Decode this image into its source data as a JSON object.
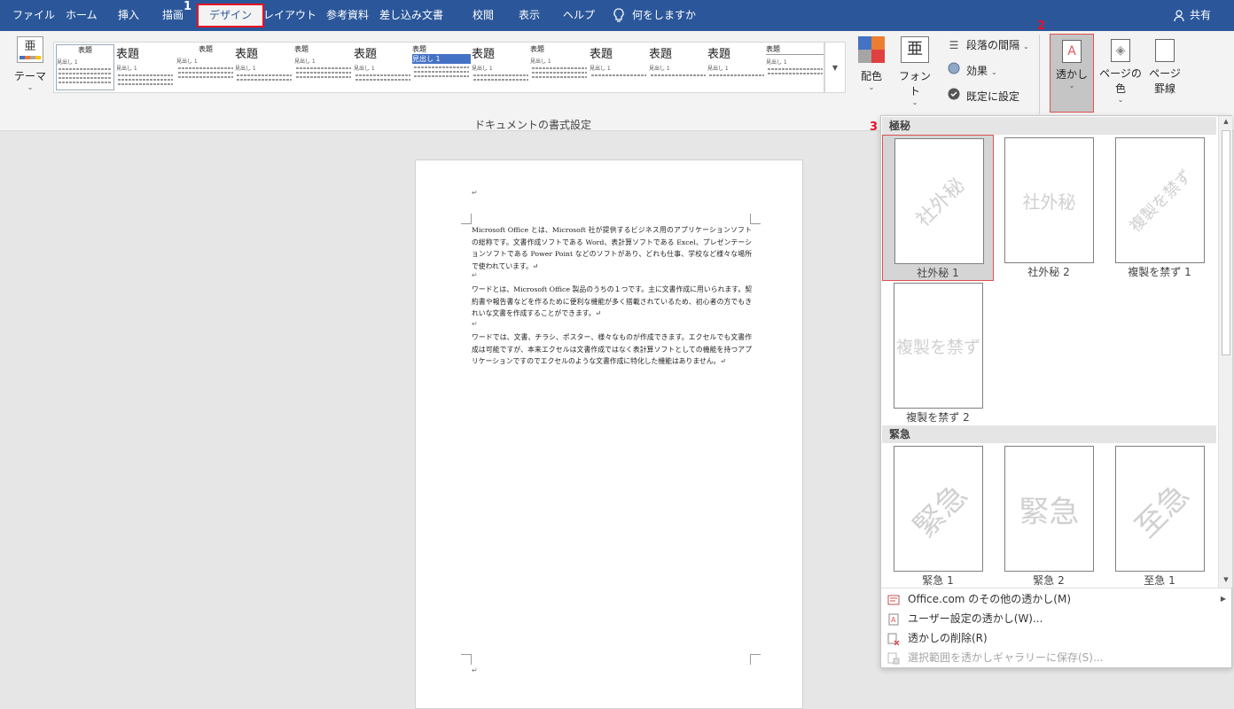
{
  "tabs": [
    "ファイル",
    "ホーム",
    "挿入",
    "描画",
    "デザイン",
    "レイアウト",
    "参考資料",
    "差し込み文書",
    "校閲",
    "表示",
    "ヘルプ"
  ],
  "tell_me": "何をしますか",
  "share": "共有",
  "steps": [
    "1",
    "2",
    "3"
  ],
  "ribbon": {
    "theme_label": "テーマ",
    "theme_glyph": "亜",
    "style_gallery": [
      {
        "title": "表題",
        "h": "見出し 1"
      },
      {
        "title": "表題",
        "h": "見出し 1"
      },
      {
        "title": "表題",
        "h": "見出し 1"
      },
      {
        "title": "表題",
        "h": "見出し 1"
      },
      {
        "title": "表題",
        "h": "見出し 1"
      },
      {
        "title": "表題",
        "h": "見出し 1"
      },
      {
        "title": "表題",
        "h": "見出し 1"
      },
      {
        "title": "表題",
        "h": "見出し 1"
      },
      {
        "title": "表題",
        "h": "見出し 1"
      },
      {
        "title": "表題",
        "h": "見出し 1"
      },
      {
        "title": "表題",
        "h": "見出し 1"
      },
      {
        "title": "表題",
        "h": "見出し 1"
      },
      {
        "title": "表題",
        "h": "見出し 1"
      }
    ],
    "group_label": "ドキュメントの書式設定",
    "colors_label": "配色",
    "fonts_label": "フォント",
    "fonts_glyph": "亜",
    "paragraph_spacing": "段落の間隔",
    "effects": "効果",
    "set_default": "既定に設定",
    "watermark": "透かし",
    "page_color": "ページの色",
    "page_borders_1": "ページ",
    "page_borders_2": "罫線",
    "colors": [
      "#4472c4",
      "#ed7d31",
      "#a5a5a5",
      "#e04040"
    ]
  },
  "document": {
    "mark": "↵",
    "paragraphs": [
      "Microsoft Office とは、Microsoft 社が提供するビジネス用のアプリケーションソフトの総称です。文書作成ソフトである Word、表計算ソフトである Excel、プレゼンテーションソフトである Power Point などのソフトがあり、どれも仕事、学校など様々な場所で使われています。↵",
      "ワードとは、Microsoft Office 製品のうちの１つです。主に文書作成に用いられます。契約書や報告書などを作るために便利な機能が多く搭載されているため、初心者の方でもきれいな文書を作成することができます。↵",
      "ワードでは、文書、チラシ、ポスター、様々なものが作成できます。エクセルでも文書作成は可能ですが、本来エクセルは文書作成ではなく表計算ソフトとしての機能を持つアプリケーションですのでエクセルのような文書作成に特化した機能はありません。↵"
    ]
  },
  "watermark_gallery": {
    "sections": [
      {
        "title": "極秘",
        "items": [
          {
            "text": "社外秘",
            "label": "社外秘 1"
          },
          {
            "text": "社外秘",
            "label": "社外秘 2"
          },
          {
            "text": "複製を禁ず",
            "label": "複製を禁ず 1"
          },
          {
            "text": "複製を禁ず",
            "label": "複製を禁ず 2"
          }
        ]
      },
      {
        "title": "緊急",
        "items": [
          {
            "text": "緊急",
            "label": "緊急 1"
          },
          {
            "text": "緊急",
            "label": "緊急 2"
          },
          {
            "text": "至急",
            "label": "至急 1"
          }
        ]
      }
    ],
    "menu": [
      {
        "text": "Office.com のその他の透かし(M)",
        "icon": "office-com-icon"
      },
      {
        "text": "ユーザー設定の透かし(W)...",
        "icon": "custom-watermark-icon"
      },
      {
        "text": "透かしの削除(R)",
        "icon": "remove-watermark-icon"
      },
      {
        "text": "選択範囲を透かしギャラリーに保存(S)...",
        "icon": "save-selection-icon"
      }
    ]
  }
}
